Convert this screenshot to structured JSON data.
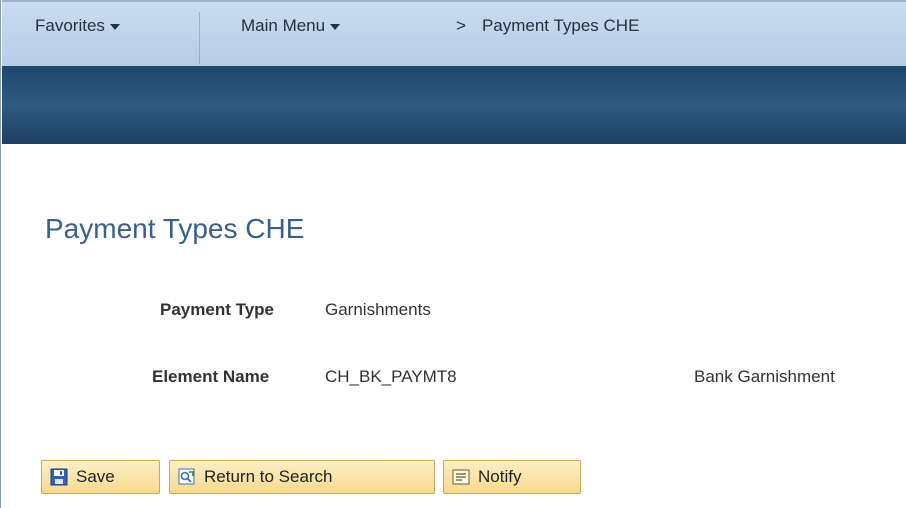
{
  "nav": {
    "favorites": "Favorites",
    "main_menu": "Main Menu",
    "breadcrumb_separator": ">",
    "breadcrumb_current": "Payment Types CHE"
  },
  "page": {
    "title": "Payment Types CHE"
  },
  "fields": {
    "payment_type_label": "Payment Type",
    "payment_type_value": "Garnishments",
    "element_name_label": "Element Name",
    "element_name_value": "CH_BK_PAYMT8",
    "element_description": "Bank Garnishment"
  },
  "toolbar": {
    "save_label": "Save",
    "return_label": "Return to Search",
    "notify_label": "Notify"
  },
  "colors": {
    "nav_bg": "#c9dcf0",
    "banner_bg": "#2f5b82",
    "title_color": "#3a5f8c",
    "button_bg": "#f6d98f"
  }
}
